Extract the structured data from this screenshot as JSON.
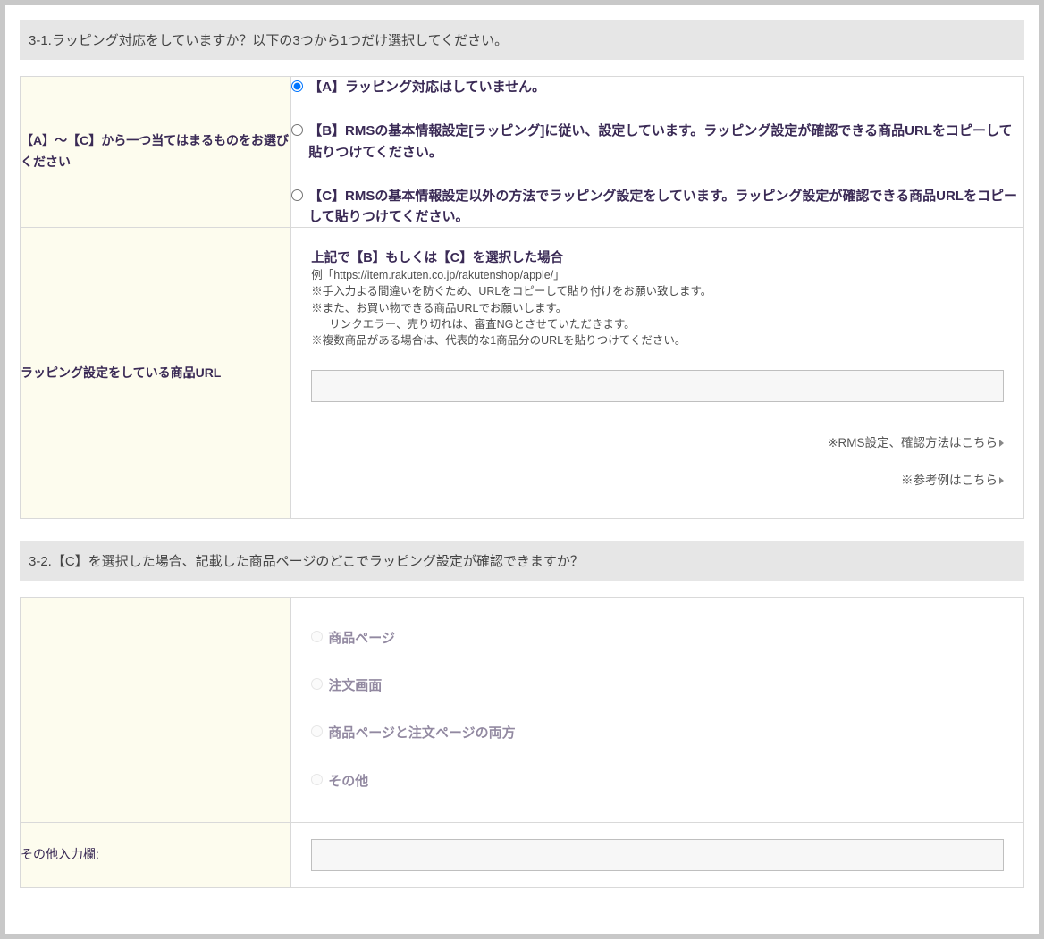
{
  "section1": {
    "header": "3-1.ラッピング対応をしていますか？以下の3つから1つだけ選択してください。",
    "row1": {
      "label": "【A】～【C】から一つ当てはまるものをお選びください",
      "options": {
        "a": "【A】ラッピング対応はしていません。",
        "b": "【B】RMSの基本情報設定[ラッピング]に従い、設定しています。ラッピング設定が確認できる商品URLをコピーして貼りつけてください。",
        "c": "【C】RMSの基本情報設定以外の方法でラッピング設定をしています。ラッピング設定が確認できる商品URLをコピーして貼りつけてください。"
      },
      "selected": "a"
    },
    "row2": {
      "label": "ラッピング設定をしている商品URL",
      "introBold": "上記で【B】もしくは【C】を選択した場合",
      "note1": "例「https://item.rakuten.co.jp/rakutenshop/apple/」",
      "note2": "※手入力よる間違いを防ぐため、URLをコピーして貼り付けをお願い致します。",
      "note3": "※また、お買い物できる商品URLでお願いします。",
      "note3b": "リンクエラー、売り切れは、審査NGとさせていただきます。",
      "note4": "※複数商品がある場合は、代表的な1商品分のURLを貼りつけてください。",
      "urlValue": "",
      "link1": "※RMS設定、確認方法はこちら",
      "link2": "※参考例はこちら"
    }
  },
  "section2": {
    "header": "3-2.【C】を選択した場合、記載した商品ページのどこでラッピング設定が確認できますか？",
    "row1": {
      "label": "",
      "options": {
        "a": "商品ページ",
        "b": "注文画面",
        "c": "商品ページと注文ページの両方",
        "d": "その他"
      }
    },
    "row2": {
      "label": "その他入力欄:",
      "value": ""
    }
  }
}
